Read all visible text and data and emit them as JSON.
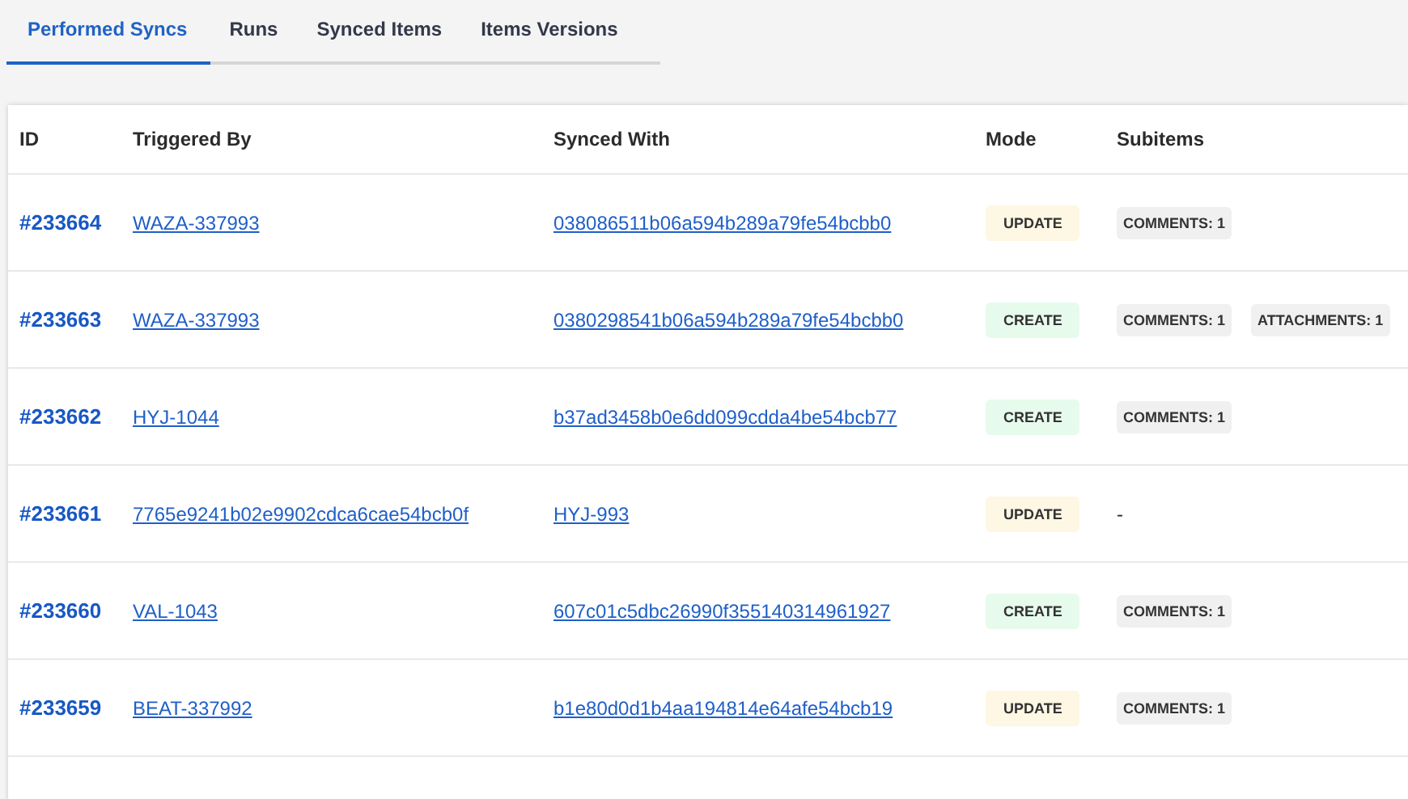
{
  "tabs": [
    {
      "label": "Performed Syncs",
      "selected": true
    },
    {
      "label": "Runs",
      "selected": false
    },
    {
      "label": "Synced Items",
      "selected": false
    },
    {
      "label": "Items Versions",
      "selected": false
    }
  ],
  "table": {
    "columns": [
      "ID",
      "Triggered By",
      "Synced With",
      "Mode",
      "Subitems"
    ],
    "rows": [
      {
        "id": "#233664",
        "triggered_by": "WAZA-337993",
        "synced_with": "038086511b06a594b289a79fe54bcbb0",
        "mode": {
          "label": "UPDATE",
          "kind": "update"
        },
        "subitems": [
          "COMMENTS: 1"
        ]
      },
      {
        "id": "#233663",
        "triggered_by": "WAZA-337993",
        "synced_with": "0380298541b06a594b289a79fe54bcbb0",
        "mode": {
          "label": "CREATE",
          "kind": "create"
        },
        "subitems": [
          "COMMENTS: 1",
          "ATTACHMENTS: 1"
        ]
      },
      {
        "id": "#233662",
        "triggered_by": "HYJ-1044",
        "synced_with": "b37ad3458b0e6dd099cdda4be54bcb77",
        "mode": {
          "label": "CREATE",
          "kind": "create"
        },
        "subitems": [
          "COMMENTS: 1"
        ]
      },
      {
        "id": "#233661",
        "triggered_by": "7765e9241b02e9902cdca6cae54bcb0f",
        "synced_with": "HYJ-993",
        "mode": {
          "label": "UPDATE",
          "kind": "update"
        },
        "subitems_placeholder": "-"
      },
      {
        "id": "#233660",
        "triggered_by": "VAL-1043",
        "synced_with": "607c01c5dbc26990f355140314961927",
        "mode": {
          "label": "CREATE",
          "kind": "create"
        },
        "subitems": [
          "COMMENTS: 1"
        ]
      },
      {
        "id": "#233659",
        "triggered_by": "BEAT-337992",
        "synced_with": "b1e80d0d1b4aa194814e64afe54bcb19",
        "mode": {
          "label": "UPDATE",
          "kind": "update"
        },
        "subitems": [
          "COMMENTS: 1"
        ]
      }
    ]
  }
}
